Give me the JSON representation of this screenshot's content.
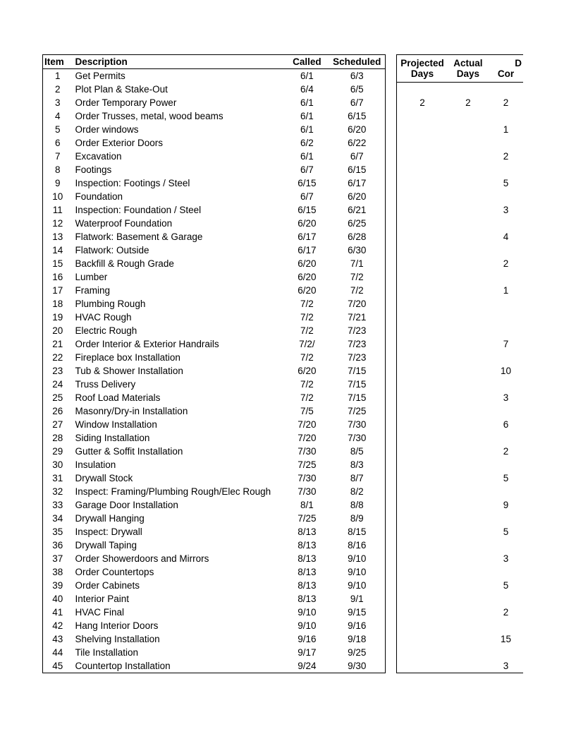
{
  "left": {
    "headers": {
      "item": "Item",
      "description": "Description",
      "called": "Called",
      "scheduled": "Scheduled"
    },
    "rows": [
      {
        "n": "1",
        "d": "Get Permits",
        "c": "6/1",
        "s": "6/3"
      },
      {
        "n": "2",
        "d": "Plot Plan & Stake-Out",
        "c": "6/4",
        "s": "6/5"
      },
      {
        "n": "3",
        "d": "Order Temporary Power",
        "c": "6/1",
        "s": "6/7"
      },
      {
        "n": "4",
        "d": "Order Trusses, metal, wood beams",
        "c": "6/1",
        "s": "6/15"
      },
      {
        "n": "5",
        "d": "Order windows",
        "c": "6/1",
        "s": "6/20"
      },
      {
        "n": "6",
        "d": "Order Exterior Doors",
        "c": "6/2",
        "s": "6/22"
      },
      {
        "n": "7",
        "d": "Excavation",
        "c": "6/1",
        "s": "6/7"
      },
      {
        "n": "8",
        "d": "Footings",
        "c": "6/7",
        "s": "6/15"
      },
      {
        "n": "9",
        "d": "Inspection: Footings / Steel",
        "c": "6/15",
        "s": "6/17"
      },
      {
        "n": "10",
        "d": "Foundation",
        "c": "6/7",
        "s": "6/20"
      },
      {
        "n": "11",
        "d": "Inspection: Foundation / Steel",
        "c": "6/15",
        "s": "6/21"
      },
      {
        "n": "12",
        "d": "Waterproof Foundation",
        "c": "6/20",
        "s": "6/25"
      },
      {
        "n": "13",
        "d": "Flatwork: Basement & Garage",
        "c": "6/17",
        "s": "6/28"
      },
      {
        "n": "14",
        "d": "Flatwork: Outside",
        "c": "6/17",
        "s": "6/30"
      },
      {
        "n": "15",
        "d": "Backfill & Rough Grade",
        "c": "6/20",
        "s": "7/1"
      },
      {
        "n": "16",
        "d": "Lumber",
        "c": "6/20",
        "s": "7/2"
      },
      {
        "n": "17",
        "d": "Framing",
        "c": "6/20",
        "s": "7/2"
      },
      {
        "n": "18",
        "d": "Plumbing Rough",
        "c": "7/2",
        "s": "7/20"
      },
      {
        "n": "19",
        "d": "HVAC Rough",
        "c": "7/2",
        "s": "7/21"
      },
      {
        "n": "20",
        "d": "Electric Rough",
        "c": "7/2",
        "s": "7/23"
      },
      {
        "n": "21",
        "d": "Order Interior & Exterior Handrails",
        "c": "7/2/",
        "s": "7/23"
      },
      {
        "n": "22",
        "d": "Fireplace box Installation",
        "c": "7/2",
        "s": "7/23"
      },
      {
        "n": "23",
        "d": "Tub & Shower Installation",
        "c": "6/20",
        "s": "7/15"
      },
      {
        "n": "24",
        "d": "Truss Delivery",
        "c": "7/2",
        "s": "7/15"
      },
      {
        "n": "25",
        "d": "Roof Load Materials",
        "c": "7/2",
        "s": "7/15"
      },
      {
        "n": "26",
        "d": "Masonry/Dry-in Installation",
        "c": "7/5",
        "s": "7/25"
      },
      {
        "n": "27",
        "d": "Window Installation",
        "c": "7/20",
        "s": "7/30"
      },
      {
        "n": "28",
        "d": "Siding Installation",
        "c": "7/20",
        "s": "7/30"
      },
      {
        "n": "29",
        "d": "Gutter & Soffit Installation",
        "c": "7/30",
        "s": "8/5"
      },
      {
        "n": "30",
        "d": "Insulation",
        "c": "7/25",
        "s": "8/3"
      },
      {
        "n": "31",
        "d": "Drywall Stock",
        "c": "7/30",
        "s": "8/7"
      },
      {
        "n": "32",
        "d": "Inspect: Framing/Plumbing Rough/Elec Rough",
        "c": "7/30",
        "s": "8/2"
      },
      {
        "n": "33",
        "d": "Garage Door Installation",
        "c": "8/1",
        "s": "8/8"
      },
      {
        "n": "34",
        "d": "Drywall Hanging",
        "c": "7/25",
        "s": "8/9"
      },
      {
        "n": "35",
        "d": "Inspect: Drywall",
        "c": "8/13",
        "s": "8/15"
      },
      {
        "n": "36",
        "d": "Drywall Taping",
        "c": "8/13",
        "s": "8/16"
      },
      {
        "n": "37",
        "d": "Order Showerdoors and Mirrors",
        "c": "8/13",
        "s": "9/10"
      },
      {
        "n": "38",
        "d": "Order Countertops",
        "c": "8/13",
        "s": "9/10"
      },
      {
        "n": "39",
        "d": "Order Cabinets",
        "c": "8/13",
        "s": "9/10"
      },
      {
        "n": "40",
        "d": "Interior Paint",
        "c": "8/13",
        "s": "9/1"
      },
      {
        "n": "41",
        "d": "HVAC Final",
        "c": "9/10",
        "s": "9/15"
      },
      {
        "n": "42",
        "d": "Hang Interior Doors",
        "c": "9/10",
        "s": "9/16"
      },
      {
        "n": "43",
        "d": "Shelving Installation",
        "c": "9/16",
        "s": "9/18"
      },
      {
        "n": "44",
        "d": "Tile Installation",
        "c": "9/17",
        "s": "9/25"
      },
      {
        "n": "45",
        "d": "Countertop Installation",
        "c": "9/24",
        "s": "9/30"
      }
    ]
  },
  "right": {
    "headers": {
      "projected_l1": "Projected",
      "projected_l2": "Days",
      "actual_l1": "Actual",
      "actual_l2": "Days",
      "dc_l1": "D",
      "dc_l2": "Cor"
    },
    "rows": [
      {
        "p": "",
        "a": "",
        "dc": ""
      },
      {
        "p": "2",
        "a": "2",
        "dc": "2"
      },
      {
        "p": "",
        "a": "",
        "dc": ""
      },
      {
        "p": "",
        "a": "",
        "dc": "1"
      },
      {
        "p": "",
        "a": "",
        "dc": ""
      },
      {
        "p": "",
        "a": "",
        "dc": "2"
      },
      {
        "p": "",
        "a": "",
        "dc": ""
      },
      {
        "p": "",
        "a": "",
        "dc": "5"
      },
      {
        "p": "",
        "a": "",
        "dc": ""
      },
      {
        "p": "",
        "a": "",
        "dc": "3"
      },
      {
        "p": "",
        "a": "",
        "dc": ""
      },
      {
        "p": "",
        "a": "",
        "dc": "4"
      },
      {
        "p": "",
        "a": "",
        "dc": ""
      },
      {
        "p": "",
        "a": "",
        "dc": "2"
      },
      {
        "p": "",
        "a": "",
        "dc": ""
      },
      {
        "p": "",
        "a": "",
        "dc": "1"
      },
      {
        "p": "",
        "a": "",
        "dc": ""
      },
      {
        "p": "",
        "a": "",
        "dc": ""
      },
      {
        "p": "",
        "a": "",
        "dc": ""
      },
      {
        "p": "",
        "a": "",
        "dc": "7"
      },
      {
        "p": "",
        "a": "",
        "dc": ""
      },
      {
        "p": "",
        "a": "",
        "dc": "10"
      },
      {
        "p": "",
        "a": "",
        "dc": ""
      },
      {
        "p": "",
        "a": "",
        "dc": "3"
      },
      {
        "p": "",
        "a": "",
        "dc": ""
      },
      {
        "p": "",
        "a": "",
        "dc": "6"
      },
      {
        "p": "",
        "a": "",
        "dc": ""
      },
      {
        "p": "",
        "a": "",
        "dc": "2"
      },
      {
        "p": "",
        "a": "",
        "dc": ""
      },
      {
        "p": "",
        "a": "",
        "dc": "5"
      },
      {
        "p": "",
        "a": "",
        "dc": ""
      },
      {
        "p": "",
        "a": "",
        "dc": "9"
      },
      {
        "p": "",
        "a": "",
        "dc": ""
      },
      {
        "p": "",
        "a": "",
        "dc": "5"
      },
      {
        "p": "",
        "a": "",
        "dc": ""
      },
      {
        "p": "",
        "a": "",
        "dc": "3"
      },
      {
        "p": "",
        "a": "",
        "dc": ""
      },
      {
        "p": "",
        "a": "",
        "dc": "5"
      },
      {
        "p": "",
        "a": "",
        "dc": ""
      },
      {
        "p": "",
        "a": "",
        "dc": "2"
      },
      {
        "p": "",
        "a": "",
        "dc": ""
      },
      {
        "p": "",
        "a": "",
        "dc": "15"
      },
      {
        "p": "",
        "a": "",
        "dc": ""
      },
      {
        "p": "",
        "a": "",
        "dc": "3"
      }
    ]
  }
}
